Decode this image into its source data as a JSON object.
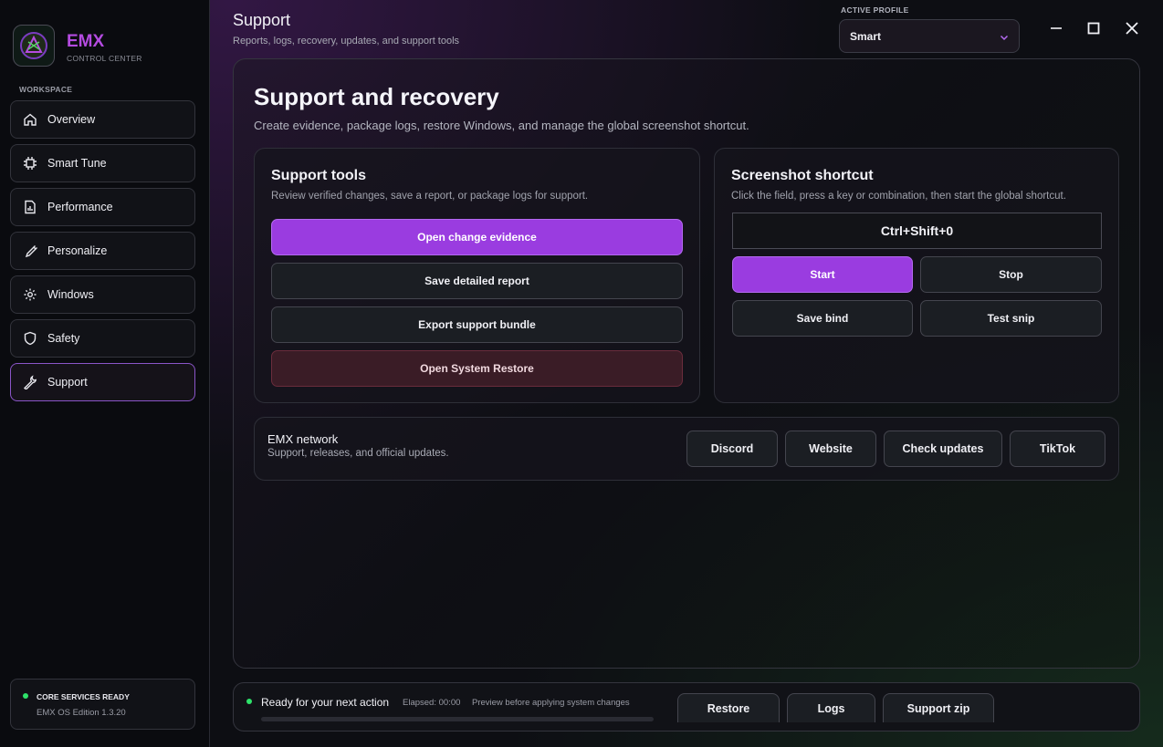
{
  "brand": {
    "name": "EMX",
    "subtitle": "CONTROL CENTER"
  },
  "sidebar": {
    "section_label": "WORKSPACE",
    "items": [
      {
        "label": "Overview",
        "icon": "home-icon"
      },
      {
        "label": "Smart Tune",
        "icon": "chip-icon"
      },
      {
        "label": "Performance",
        "icon": "chart-icon"
      },
      {
        "label": "Personalize",
        "icon": "brush-icon"
      },
      {
        "label": "Windows",
        "icon": "gear-icon"
      },
      {
        "label": "Safety",
        "icon": "shield-icon"
      },
      {
        "label": "Support",
        "icon": "wrench-icon",
        "active": true
      }
    ],
    "status": {
      "title": "CORE SERVICES READY",
      "version": "EMX OS Edition 1.3.20"
    }
  },
  "header": {
    "title": "Support",
    "subtitle": "Reports, logs, recovery, updates, and support tools",
    "profile_label": "ACTIVE PROFILE",
    "profile_value": "Smart"
  },
  "main": {
    "title": "Support and recovery",
    "subtitle": "Create evidence, package logs, restore Windows, and manage the global screenshot shortcut."
  },
  "support_tools": {
    "title": "Support tools",
    "subtitle": "Review verified changes, save a report, or package logs for support.",
    "buttons": {
      "evidence": "Open change evidence",
      "report": "Save detailed report",
      "bundle": "Export support bundle",
      "restore": "Open System Restore"
    }
  },
  "shortcut": {
    "title": "Screenshot shortcut",
    "subtitle": "Click the field, press a key or combination, then start the global shortcut.",
    "key_value": "Ctrl+Shift+0",
    "buttons": {
      "start": "Start",
      "stop": "Stop",
      "save": "Save bind",
      "test": "Test snip"
    }
  },
  "network": {
    "title": "EMX network",
    "subtitle": "Support, releases, and official updates.",
    "buttons": {
      "discord": "Discord",
      "website": "Website",
      "updates": "Check updates",
      "tiktok": "TikTok"
    }
  },
  "footer": {
    "status": "Ready for your next action",
    "elapsed": "Elapsed: 00:00",
    "preview": "Preview before applying system changes",
    "progress": 0,
    "buttons": {
      "restore": "Restore",
      "logs": "Logs",
      "zip": "Support zip"
    }
  },
  "colors": {
    "accent": "#9a3ce0",
    "brand": "#b44be0",
    "ready": "#2ee26a",
    "danger_bg": "#3a1c26"
  }
}
